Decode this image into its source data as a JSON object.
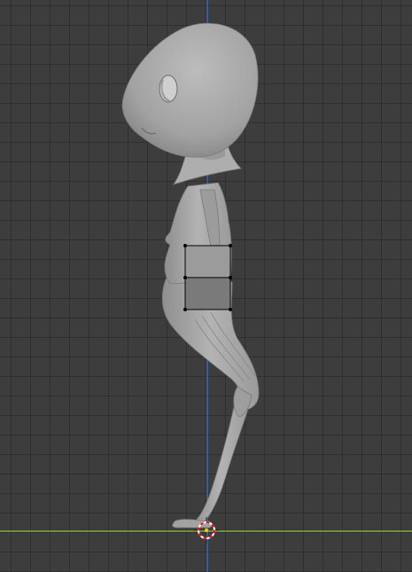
{
  "viewport": {
    "view": "side-orthographic",
    "background_color": "#3d3d3d",
    "grid_color": "#333333",
    "x_axis_color": "#8cc34a",
    "z_axis_color": "#3a6bb5",
    "model_color": "#a6a6a6",
    "model_shadow_color": "#7e7e7e",
    "selected_face_color": "#9b9b9b",
    "unselected_face_color": "#7a7a7a",
    "vertex_color": "#000000",
    "cursor_icon": "3d-cursor-icon",
    "cursor_colors": [
      "#ff0000",
      "#ffffff"
    ]
  }
}
